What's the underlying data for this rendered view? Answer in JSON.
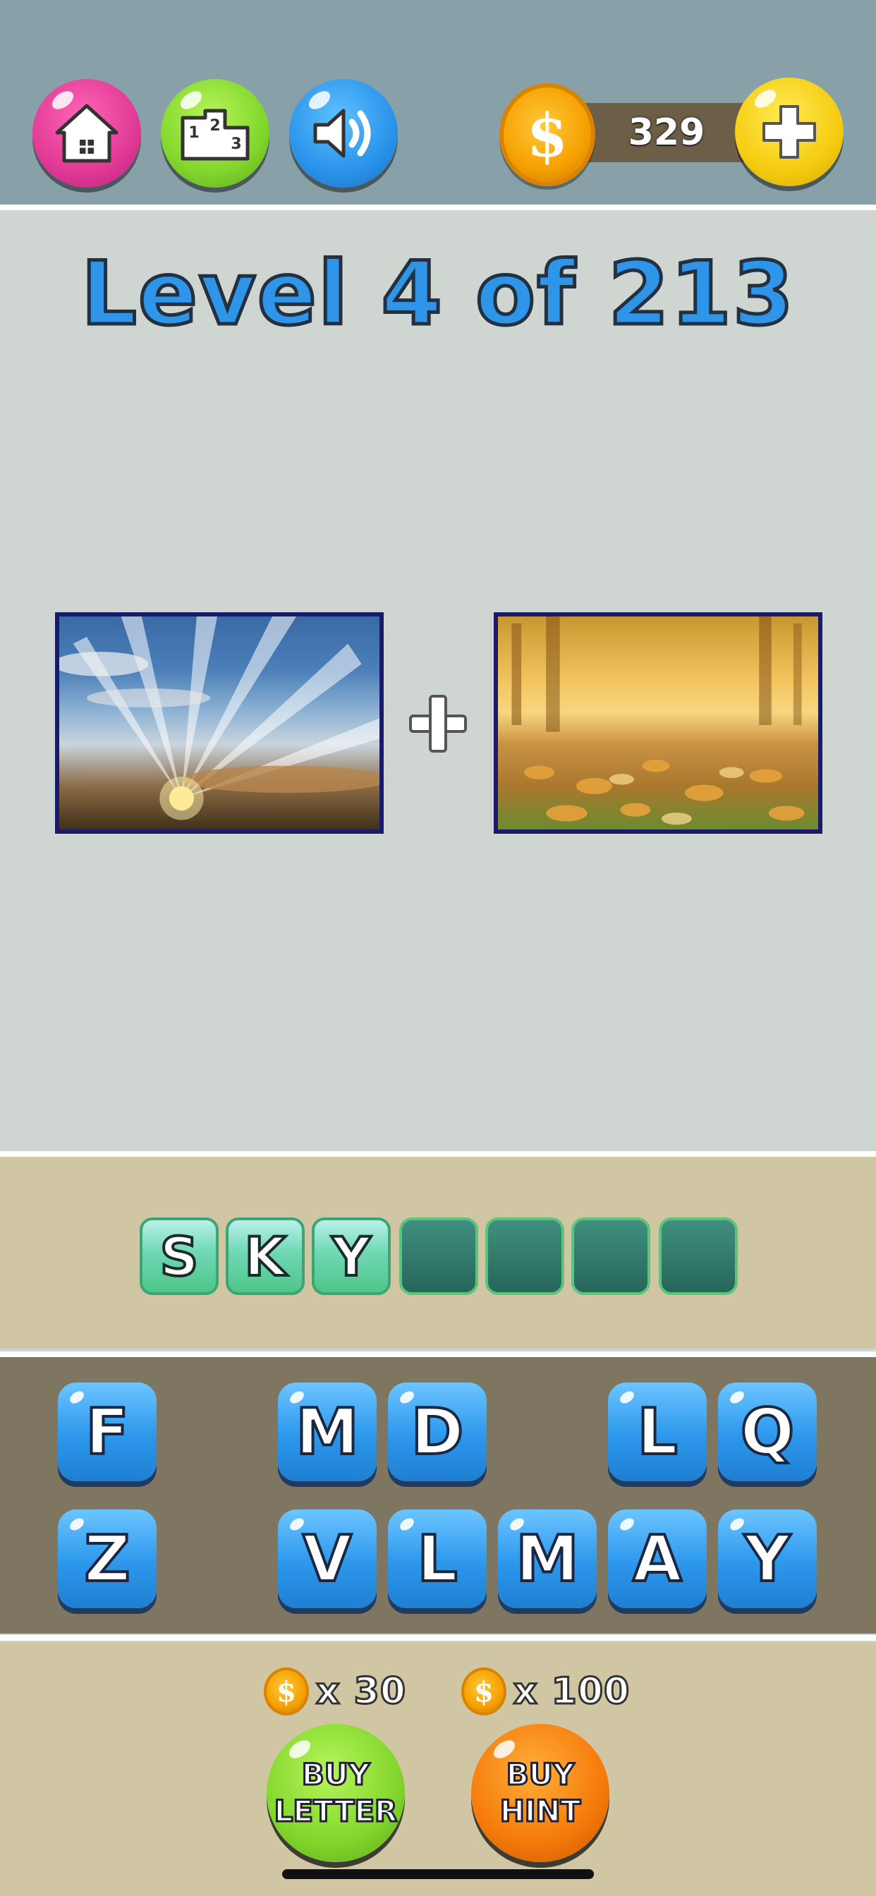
{
  "header": {
    "icons": [
      "home-icon",
      "leaderboard-podium-icon",
      "speaker-icon",
      "plus-icon",
      "coin-dollar-icon"
    ],
    "coins": "329",
    "coin_symbol": "$"
  },
  "level": {
    "title": "Level 4 of 213"
  },
  "clues": {
    "images": [
      "sky-with-sun-rays-photo",
      "autumn-leaves-on-grass-photo"
    ],
    "joiner_icon": "plus-icon"
  },
  "answer": {
    "slots": [
      "S",
      "K",
      "Y",
      "",
      "",
      "",
      ""
    ]
  },
  "letters": {
    "row1": [
      "F",
      "",
      "M",
      "D",
      "",
      "L",
      "Q"
    ],
    "row2": [
      "Z",
      "",
      "V",
      "L",
      "M",
      "A",
      "Y"
    ]
  },
  "shop": {
    "letter_price": "x 30",
    "hint_price": "x 100",
    "buy_letter_label": "BUY\nLETTER",
    "buy_hint_label": "BUY\nHINT"
  },
  "colors": {
    "header_bg": "#88a0a8",
    "board_bg": "#cfd6d2",
    "answer_bg": "#d1c6a4",
    "letters_bg": "#7e7660",
    "title_blue": "#2e95e8"
  }
}
